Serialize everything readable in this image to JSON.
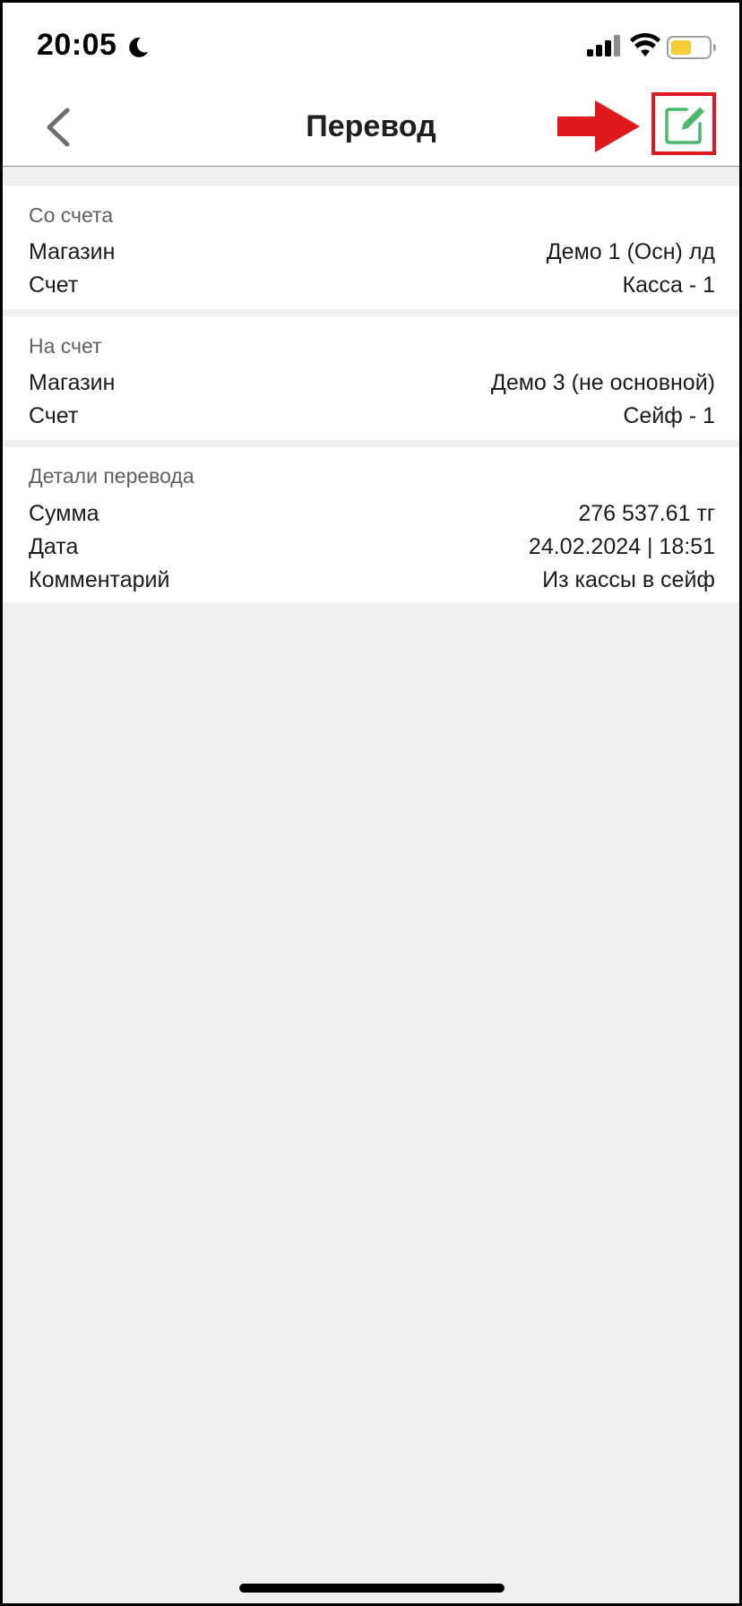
{
  "status_bar": {
    "time": "20:05",
    "icons": [
      "moon-icon",
      "cellular-signal-icon",
      "wifi-icon",
      "battery-icon"
    ],
    "battery_color": "#f5cb36"
  },
  "nav": {
    "title": "Перевод",
    "back_icon": "chevron-left-icon",
    "edit_icon": "edit-icon",
    "edit_icon_color": "#48b96a",
    "highlight_color": "#e0191f"
  },
  "sections": {
    "from": {
      "title": "Со счета",
      "rows": [
        {
          "label": "Магазин",
          "value": "Демо 1 (Осн) лд"
        },
        {
          "label": "Счет",
          "value": "Касса - 1"
        }
      ]
    },
    "to": {
      "title": "На счет",
      "rows": [
        {
          "label": "Магазин",
          "value": "Демо 3 (не основной)"
        },
        {
          "label": "Счет",
          "value": "Сейф - 1"
        }
      ]
    },
    "details": {
      "title": "Детали перевода",
      "rows": [
        {
          "label": "Сумма",
          "value": "276 537.61 тг"
        },
        {
          "label": "Дата",
          "value": "24.02.2024 | 18:51"
        },
        {
          "label": "Комментарий",
          "value": "Из кассы в сейф"
        }
      ]
    }
  }
}
